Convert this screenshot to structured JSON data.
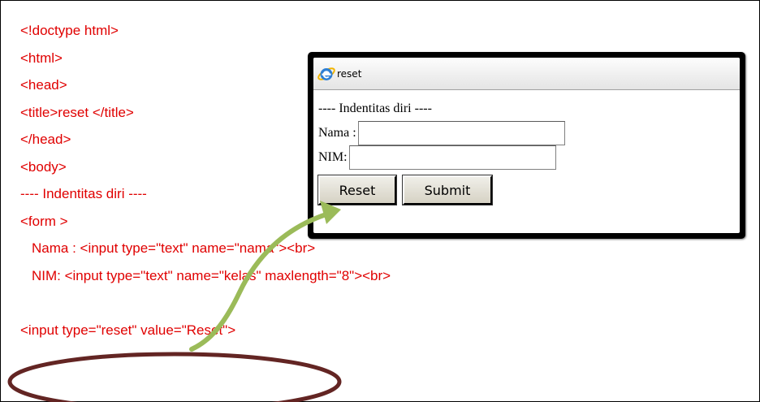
{
  "code_lines": [
    "<!doctype html>",
    "<html>",
    "<head>",
    "<title>reset </title>",
    "</head>",
    "<body>",
    "---- Indentitas diri ----",
    "<form >",
    "Nama : <input type=\"text\" name=\"nama\"><br>",
    "NIM: <input type=\"text\" name=\"kelas\" maxlength=\"8\"><br>",
    "",
    "<input type=\"reset\" value=\"Reset\">"
  ],
  "colors": {
    "code_text": "#e00000",
    "arrow": "#9bbb59",
    "ellipse": "#632523"
  },
  "browser": {
    "icon": "ie-logo-icon",
    "title": "reset",
    "heading": "---- Indentitas diri ----",
    "nama_label": "Nama :",
    "nama_value": "",
    "nim_label": "NIM:",
    "nim_value": "",
    "reset_label": "Reset",
    "submit_label": "Submit"
  }
}
